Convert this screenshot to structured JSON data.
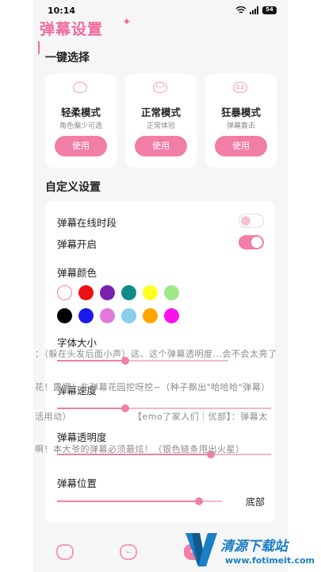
{
  "status": {
    "time": "10:14",
    "battery": "54"
  },
  "app_title": "弹幕设置",
  "one_click": {
    "title": "一键选择",
    "modes": [
      {
        "name": "轻柔模式",
        "desc": "角色偏少可选",
        "button": "使用"
      },
      {
        "name": "正常模式",
        "desc": "正常体验",
        "button": "使用"
      },
      {
        "name": "狂暴模式",
        "desc": "弹幕轰击",
        "button": "使用"
      }
    ]
  },
  "custom": {
    "title": "自定义设置",
    "online_period": {
      "label": "弹幕在线时段",
      "on": false
    },
    "danmaku_on": {
      "label": "弹幕开启",
      "on": true
    },
    "color": {
      "label": "弹幕颜色",
      "swatches": [
        "#ffffff",
        "#ee1111",
        "#7a1fb0",
        "#138a8a",
        "#ffff22",
        "#9ee88a",
        "#000000",
        "#1a1af0",
        "#e07ad8",
        "#87ceeb",
        "#ffa500",
        "#ff11ee"
      ],
      "selected": "#ffffff"
    },
    "font_size": {
      "label": "字体大小",
      "value": 0.4
    },
    "speed": {
      "label": "弹幕速度",
      "value": 0.32
    },
    "opacity": {
      "label": "弹幕透明度",
      "value": 0.72
    },
    "position": {
      "label": "弹幕位置",
      "value": 0.86,
      "value_label": "底部"
    }
  },
  "danmaku_lines": [
    "：（躲在头发后面小声）这、这个弹幕透明度...会不会太亮了",
    "花！露娜！在弹幕花园挖呀挖~（种子飘出\"哈哈哈\"弹幕）",
    "活用动）",
    "【emo了家人们｜优部】：弹幕太",
    "啊！本大爷的弹幕必须最炫！（银色链条甩出火星）"
  ],
  "watermark": {
    "name": "清源下载站",
    "url": "www.fotimeit.com"
  },
  "colors": {
    "accent": "#f17ea6",
    "title_pink": "#f06b9c",
    "bg": "#f6f6f7"
  }
}
